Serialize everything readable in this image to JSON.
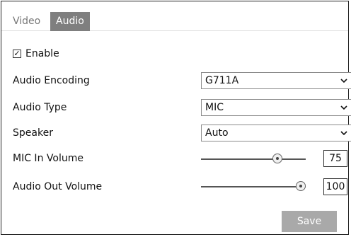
{
  "tabs": [
    {
      "label": "Video",
      "active": false
    },
    {
      "label": "Audio",
      "active": true
    }
  ],
  "enable": {
    "label": "Enable",
    "checked": true
  },
  "fields": {
    "audio_encoding": {
      "label": "Audio Encoding",
      "value": "G711A"
    },
    "audio_type": {
      "label": "Audio Type",
      "value": "MIC"
    },
    "speaker": {
      "label": "Speaker",
      "value": "Auto"
    },
    "mic_in_volume": {
      "label": "MIC In Volume",
      "value": "75",
      "level": 0.75
    },
    "audio_out_volume": {
      "label": "Audio Out Volume",
      "value": "100",
      "level": 1.0
    }
  },
  "save_label": "Save",
  "colors": {
    "active_tab": "#7f7f7f",
    "save_button": "#a9a9a9"
  }
}
